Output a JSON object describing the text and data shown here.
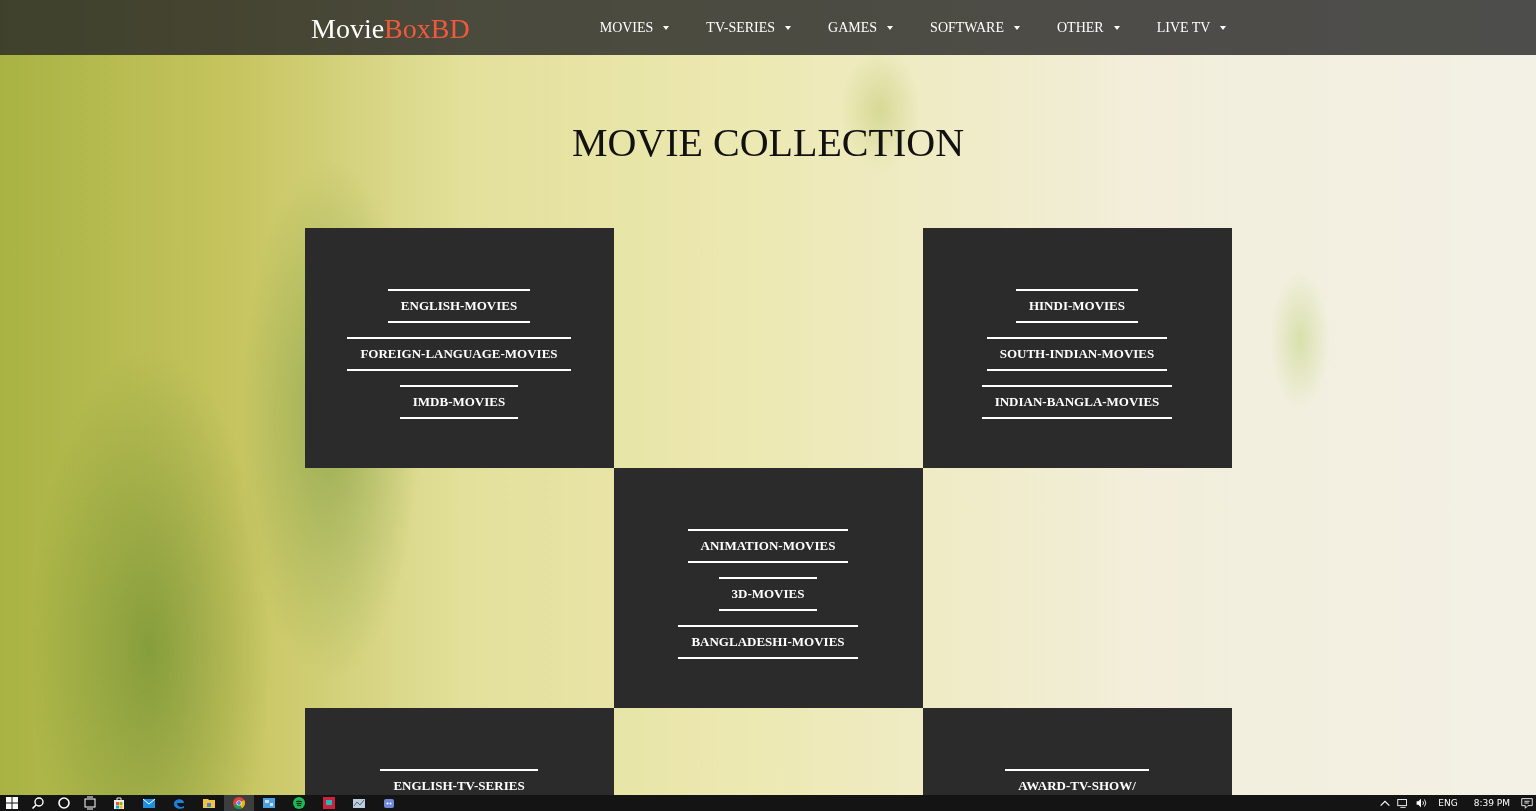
{
  "header": {
    "logo": {
      "first": "Movie",
      "second": "BoxBD"
    },
    "nav": [
      {
        "label": "MOVIES"
      },
      {
        "label": "TV-SERIES"
      },
      {
        "label": "GAMES"
      },
      {
        "label": "SOFTWARE"
      },
      {
        "label": "OTHER"
      },
      {
        "label": "LIVE TV"
      }
    ]
  },
  "title": "MOVIE COLLECTION",
  "grid": [
    {
      "cells": [
        {
          "kind": "tile",
          "links": [
            "ENGLISH-MOVIES",
            "FOREIGN-LANGUAGE-MOVIES",
            "IMDB-MOVIES"
          ]
        },
        {
          "kind": "empty"
        },
        {
          "kind": "tile",
          "links": [
            "HINDI-MOVIES",
            "SOUTH-INDIAN-MOVIES",
            "INDIAN-BANGLA-MOVIES"
          ]
        }
      ]
    },
    {
      "cells": [
        {
          "kind": "empty"
        },
        {
          "kind": "tile",
          "links": [
            "ANIMATION-MOVIES",
            "3D-MOVIES",
            "BANGLADESHI-MOVIES"
          ]
        },
        {
          "kind": "empty"
        }
      ]
    },
    {
      "cells": [
        {
          "kind": "tile",
          "links": [
            "ENGLISH-TV-SERIES"
          ]
        },
        {
          "kind": "empty"
        },
        {
          "kind": "tile",
          "links": [
            "AWARD-TV-SHOW/"
          ]
        }
      ]
    }
  ],
  "taskbar": {
    "apps": [
      {
        "kind": "store",
        "selected": false
      },
      {
        "kind": "mail",
        "selected": false
      },
      {
        "kind": "edge",
        "selected": false
      },
      {
        "kind": "folder",
        "selected": false
      },
      {
        "kind": "chrome",
        "selected": true
      },
      {
        "kind": "photos",
        "selected": false
      },
      {
        "kind": "spotify",
        "selected": false
      },
      {
        "kind": "redapp",
        "selected": false
      },
      {
        "kind": "network",
        "selected": false
      },
      {
        "kind": "chat",
        "selected": false
      }
    ],
    "language": "ENG",
    "time": "8:39 PM"
  }
}
